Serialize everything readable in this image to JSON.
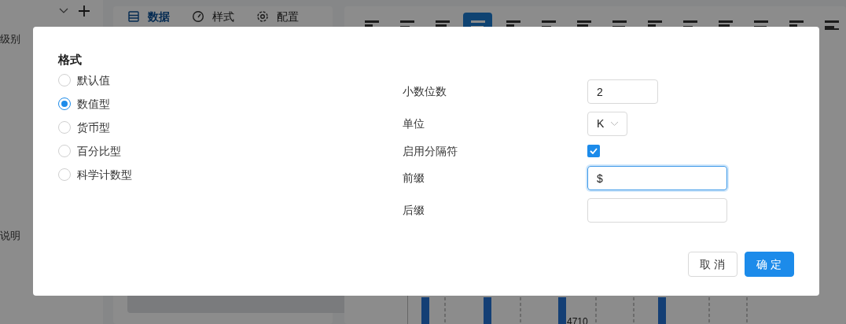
{
  "sidebar": {
    "labels": [
      "级别",
      "说明"
    ]
  },
  "panel_tabs": [
    {
      "label": "数据",
      "selected": true
    },
    {
      "label": "样式",
      "selected": false
    },
    {
      "label": "配置",
      "selected": false
    }
  ],
  "chart_types": [
    {
      "selected": false
    },
    {
      "selected": false
    },
    {
      "selected": false
    },
    {
      "selected": true
    },
    {
      "selected": false
    },
    {
      "selected": false
    },
    {
      "selected": false
    },
    {
      "selected": false
    },
    {
      "selected": false
    },
    {
      "selected": false
    },
    {
      "selected": false
    },
    {
      "selected": false
    },
    {
      "selected": false
    },
    {
      "selected": false
    }
  ],
  "chart": {
    "value_label": "4710"
  },
  "dialog": {
    "title": "格式",
    "format_options": [
      {
        "label": "默认值",
        "selected": false
      },
      {
        "label": "数值型",
        "selected": true
      },
      {
        "label": "货币型",
        "selected": false
      },
      {
        "label": "百分比型",
        "selected": false
      },
      {
        "label": "科学计数型",
        "selected": false
      }
    ],
    "fields": [
      {
        "kind": "number",
        "label": "小数位数",
        "value": "2"
      },
      {
        "kind": "select",
        "label": "单位",
        "value": "K"
      },
      {
        "kind": "checkbox",
        "label": "启用分隔符",
        "checked": true
      },
      {
        "kind": "text",
        "label": "前缀",
        "value": "$",
        "focused": true
      },
      {
        "kind": "text",
        "label": "后缀",
        "focused": false
      }
    ],
    "buttons": [
      {
        "label": "取消",
        "kind": "default"
      },
      {
        "label": "确定",
        "kind": "primary"
      }
    ]
  }
}
